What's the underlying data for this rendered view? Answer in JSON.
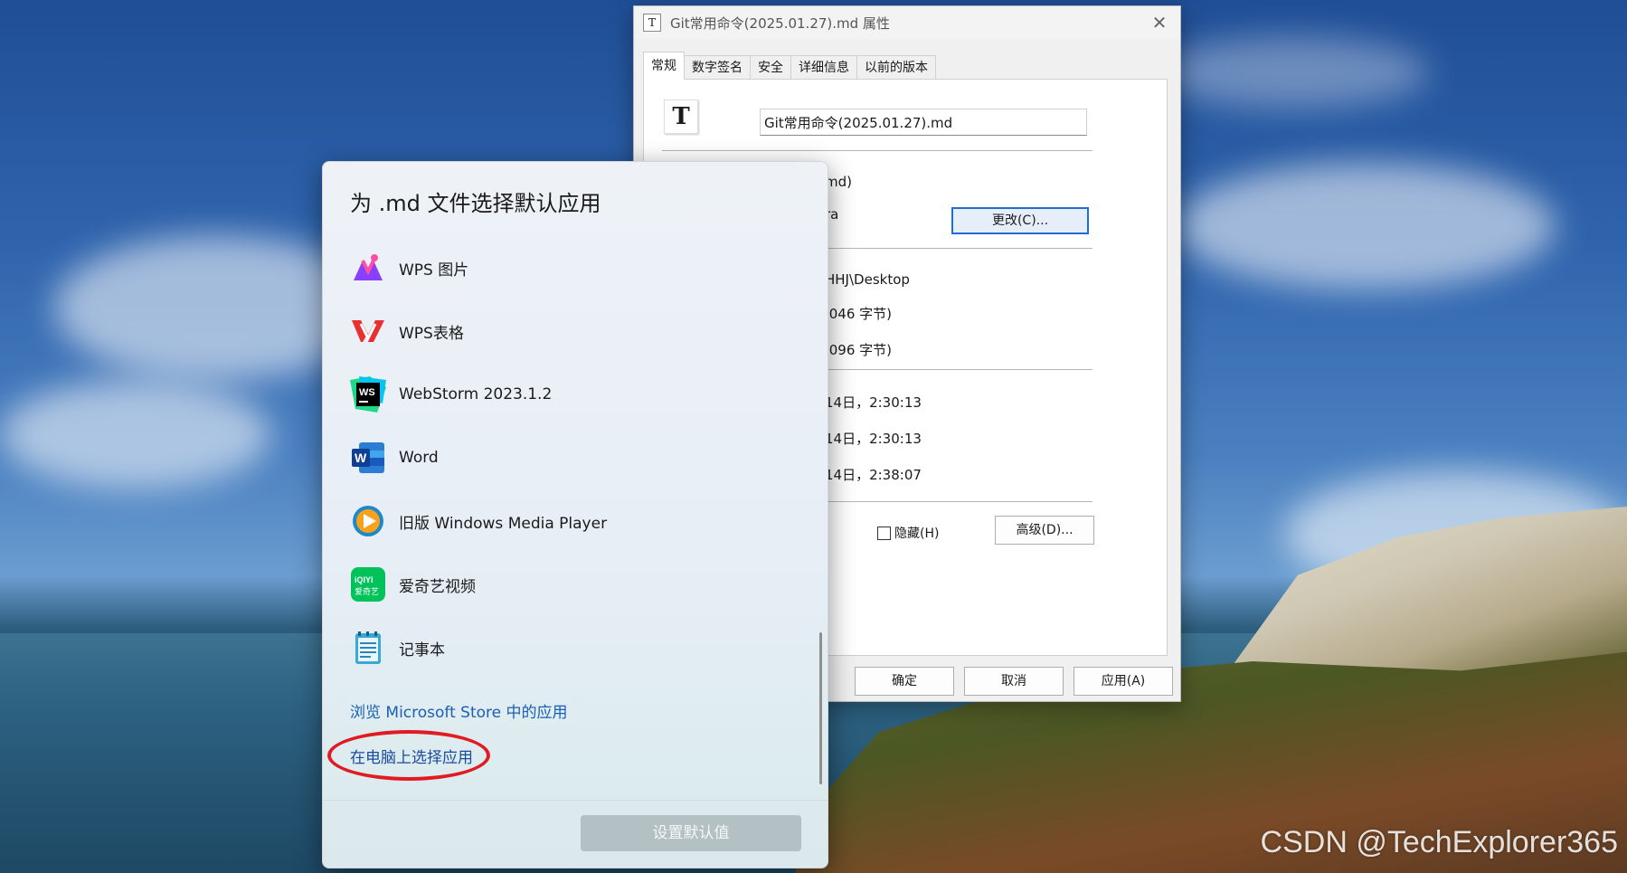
{
  "properties_dialog": {
    "title": "Git常用命令(2025.01.27).md 属性",
    "close_symbol": "✕",
    "title_icon_glyph": "T",
    "tabs": [
      "常规",
      "数字签名",
      "安全",
      "详细信息",
      "以前的版本"
    ],
    "file_icon_glyph": "T",
    "file_name": "Git常用命令(2025.01.27).md",
    "type_fragment": "md)",
    "opens_with_fragment": "ra",
    "change_button": "更改(C)...",
    "location_fragment": "HHJ\\Desktop",
    "size_fragment": ",046 字节)",
    "size_on_disk_fragment": ",096 字节)",
    "created_fragment": "14日，2:30:13",
    "modified_fragment": "14日，2:30:13",
    "accessed_fragment": "14日，2:38:07",
    "hidden_label": "隐藏(H)",
    "advanced_button": "高级(D)...",
    "ok_button": "确定",
    "cancel_button": "取消",
    "apply_button": "应用(A)"
  },
  "chooser": {
    "title": "为 .md 文件选择默认应用",
    "apps": [
      {
        "label": "WPS 图片",
        "icon": "wps-pictures-icon"
      },
      {
        "label": "WPS表格",
        "icon": "wps-office-icon"
      },
      {
        "label": "WebStorm 2023.1.2",
        "icon": "webstorm-icon"
      },
      {
        "label": "Word",
        "icon": "word-icon"
      },
      {
        "label": "旧版 Windows Media Player",
        "icon": "windows-media-player-icon"
      },
      {
        "label": "爱奇艺视频",
        "icon": "iqiyi-icon"
      },
      {
        "label": "记事本",
        "icon": "notepad-icon"
      }
    ],
    "icon_text": {
      "webstorm": "WS",
      "word": "W",
      "iqiyi_top": "iQIYI",
      "iqiyi_bottom": "爱奇艺"
    },
    "store_link": "浏览 Microsoft Store 中的应用",
    "pc_link": "在电脑上选择应用",
    "set_default_button": "设置默认值"
  },
  "watermark": "CSDN @TechExplorer365",
  "colors": {
    "link": "#1a5fb4",
    "highlight_ring": "#e01b24",
    "button_focus": "#1f6fcf"
  }
}
